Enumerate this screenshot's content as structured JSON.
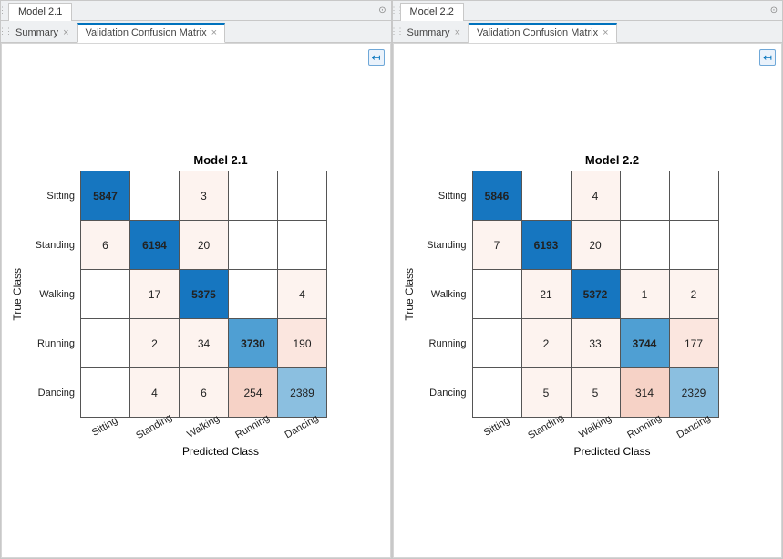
{
  "panels": [
    {
      "window_tab": "Model 2.1",
      "doc_tabs": {
        "summary": "Summary",
        "matrix": "Validation Confusion Matrix"
      }
    },
    {
      "window_tab": "Model 2.2",
      "doc_tabs": {
        "summary": "Summary",
        "matrix": "Validation Confusion Matrix"
      }
    }
  ],
  "axis": {
    "x": "Predicted Class",
    "y": "True Class"
  },
  "classes": [
    "Sitting",
    "Standing",
    "Walking",
    "Running",
    "Dancing"
  ],
  "chart_data": [
    {
      "type": "heatmap",
      "title": "Model 2.1",
      "xlabel": "Predicted Class",
      "ylabel": "True Class",
      "categories": [
        "Sitting",
        "Standing",
        "Walking",
        "Running",
        "Dancing"
      ],
      "matrix": [
        [
          5847,
          null,
          3,
          null,
          null
        ],
        [
          6,
          6194,
          20,
          null,
          null
        ],
        [
          null,
          17,
          5375,
          null,
          4
        ],
        [
          null,
          2,
          34,
          3730,
          190
        ],
        [
          null,
          4,
          6,
          254,
          2389
        ]
      ]
    },
    {
      "type": "heatmap",
      "title": "Model 2.2",
      "xlabel": "Predicted Class",
      "ylabel": "True Class",
      "categories": [
        "Sitting",
        "Standing",
        "Walking",
        "Running",
        "Dancing"
      ],
      "matrix": [
        [
          5846,
          null,
          4,
          null,
          null
        ],
        [
          7,
          6193,
          20,
          null,
          null
        ],
        [
          null,
          21,
          5372,
          1,
          2
        ],
        [
          null,
          2,
          33,
          3744,
          177
        ],
        [
          null,
          5,
          5,
          314,
          2329
        ]
      ]
    }
  ]
}
